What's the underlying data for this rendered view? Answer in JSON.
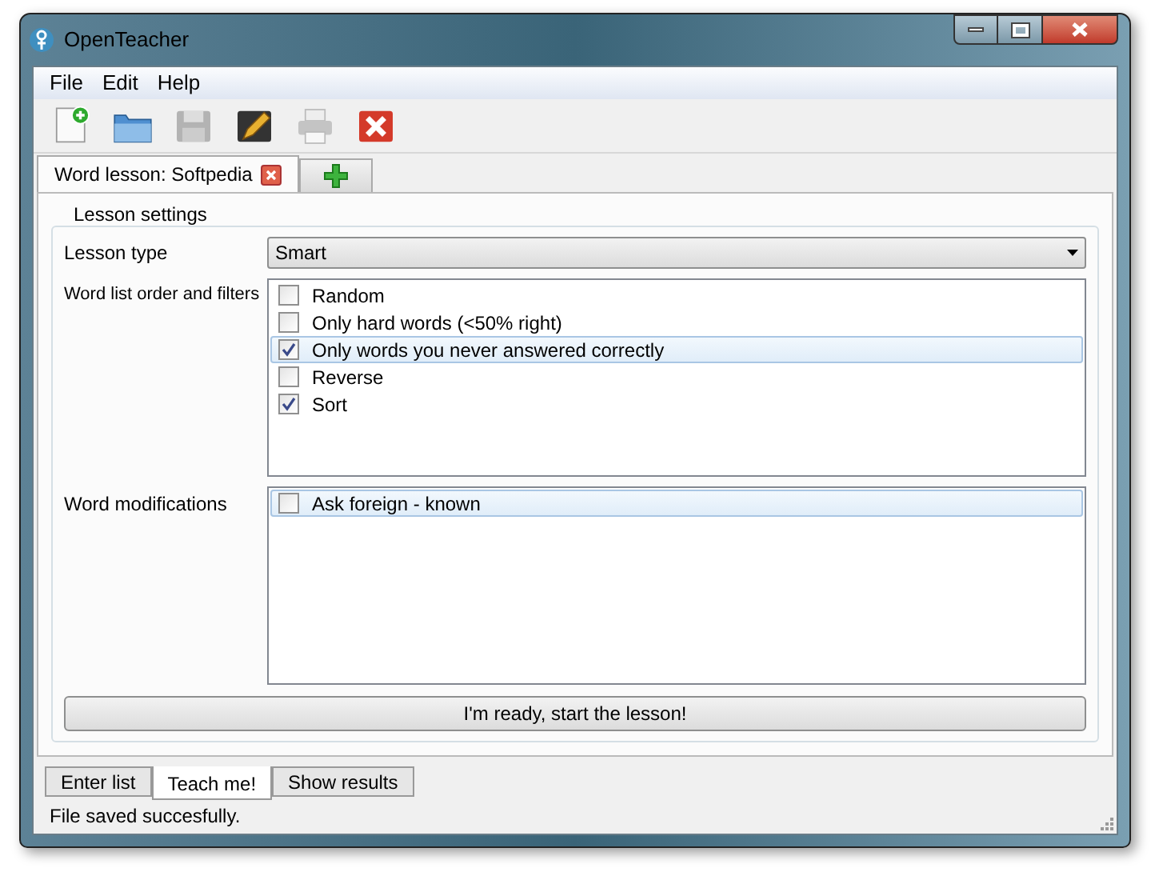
{
  "window": {
    "title": "OpenTeacher"
  },
  "menu": [
    "File",
    "Edit",
    "Help"
  ],
  "toolbar": [
    {
      "kind": "new",
      "disabled": false
    },
    {
      "kind": "open",
      "disabled": false
    },
    {
      "kind": "save",
      "disabled": true
    },
    {
      "kind": "edit",
      "disabled": false
    },
    {
      "kind": "print",
      "disabled": true
    },
    {
      "kind": "close",
      "disabled": false
    }
  ],
  "document_tabs": [
    {
      "label": "Word lesson: Softpedia",
      "selected": true
    }
  ],
  "settings": {
    "title": "Lesson settings",
    "lesson_type": {
      "label": "Lesson type",
      "value": "Smart"
    },
    "order_filters": {
      "label": "Word list order and filters",
      "items": [
        {
          "label": "Random",
          "checked": false,
          "selected": false
        },
        {
          "label": "Only hard words (<50% right)",
          "checked": false,
          "selected": false
        },
        {
          "label": "Only words you never answered correctly",
          "checked": true,
          "selected": true
        },
        {
          "label": "Reverse",
          "checked": false,
          "selected": false
        },
        {
          "label": "Sort",
          "checked": true,
          "selected": false
        }
      ]
    },
    "modifications": {
      "label": "Word modifications",
      "items": [
        {
          "label": "Ask foreign - known",
          "checked": false,
          "selected": true
        }
      ]
    },
    "start_button": "I'm ready, start the lesson!"
  },
  "mode_tabs": [
    {
      "label": "Enter list",
      "selected": false
    },
    {
      "label": "Teach me!",
      "selected": true
    },
    {
      "label": "Show results",
      "selected": false
    }
  ],
  "status_bar": "File saved succesfully."
}
